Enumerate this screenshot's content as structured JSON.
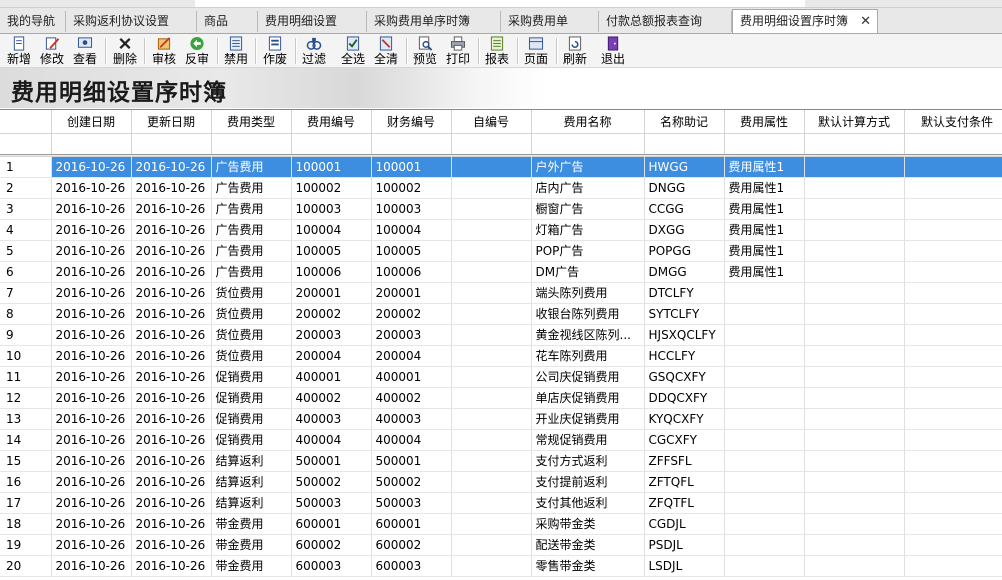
{
  "tabs": [
    {
      "label": "我的导航"
    },
    {
      "label": "采购返利协议设置"
    },
    {
      "label": "商品"
    },
    {
      "label": "费用明细设置"
    },
    {
      "label": "采购费用单序时簿"
    },
    {
      "label": "采购费用单"
    },
    {
      "label": "付款总额报表查询"
    },
    {
      "label": "费用明细设置序时簿",
      "active": true
    }
  ],
  "toolbar": [
    {
      "label": "新增",
      "icon": "new-doc-icon"
    },
    {
      "label": "修改",
      "icon": "edit-icon"
    },
    {
      "label": "查看",
      "icon": "view-icon"
    },
    {
      "label": "删除",
      "icon": "delete-icon"
    },
    {
      "label": "审核",
      "icon": "approve-icon"
    },
    {
      "label": "反审",
      "icon": "unapprove-icon"
    },
    {
      "label": "禁用",
      "icon": "disable-icon"
    },
    {
      "label": "作废",
      "icon": "void-icon"
    },
    {
      "label": "过滤",
      "icon": "filter-icon"
    },
    {
      "label": "全选",
      "icon": "select-all-icon"
    },
    {
      "label": "全清",
      "icon": "clear-all-icon"
    },
    {
      "label": "预览",
      "icon": "preview-icon"
    },
    {
      "label": "打印",
      "icon": "print-icon"
    },
    {
      "label": "报表",
      "icon": "report-icon"
    },
    {
      "label": "页面",
      "icon": "page-icon"
    },
    {
      "label": "刷新",
      "icon": "refresh-icon"
    },
    {
      "label": "退出",
      "icon": "exit-icon"
    }
  ],
  "page_title": "费用明细设置序时簿",
  "columns": [
    "创建日期",
    "更新日期",
    "费用类型",
    "费用编号",
    "财务编号",
    "自编号",
    "费用名称",
    "名称助记",
    "费用属性",
    "默认计算方式",
    "默认支付条件"
  ],
  "rows": [
    [
      "1",
      "2016-10-26",
      "2016-10-26",
      "广告费用",
      "100001",
      "100001",
      "",
      "户外广告",
      "HWGG",
      "费用属性1",
      "",
      ""
    ],
    [
      "2",
      "2016-10-26",
      "2016-10-26",
      "广告费用",
      "100002",
      "100002",
      "",
      "店内广告",
      "DNGG",
      "费用属性1",
      "",
      ""
    ],
    [
      "3",
      "2016-10-26",
      "2016-10-26",
      "广告费用",
      "100003",
      "100003",
      "",
      "橱窗广告",
      "CCGG",
      "费用属性1",
      "",
      ""
    ],
    [
      "4",
      "2016-10-26",
      "2016-10-26",
      "广告费用",
      "100004",
      "100004",
      "",
      "灯箱广告",
      "DXGG",
      "费用属性1",
      "",
      ""
    ],
    [
      "5",
      "2016-10-26",
      "2016-10-26",
      "广告费用",
      "100005",
      "100005",
      "",
      "POP广告",
      "POPGG",
      "费用属性1",
      "",
      ""
    ],
    [
      "6",
      "2016-10-26",
      "2016-10-26",
      "广告费用",
      "100006",
      "100006",
      "",
      "DM广告",
      "DMGG",
      "费用属性1",
      "",
      ""
    ],
    [
      "7",
      "2016-10-26",
      "2016-10-26",
      "货位费用",
      "200001",
      "200001",
      "",
      "端头陈列费用",
      "DTCLFY",
      "",
      "",
      ""
    ],
    [
      "8",
      "2016-10-26",
      "2016-10-26",
      "货位费用",
      "200002",
      "200002",
      "",
      "收银台陈列费用",
      "SYTCLFY",
      "",
      "",
      ""
    ],
    [
      "9",
      "2016-10-26",
      "2016-10-26",
      "货位费用",
      "200003",
      "200003",
      "",
      "黄金视线区陈列...",
      "HJSXQCLFY",
      "",
      "",
      ""
    ],
    [
      "10",
      "2016-10-26",
      "2016-10-26",
      "货位费用",
      "200004",
      "200004",
      "",
      "花车陈列费用",
      "HCCLFY",
      "",
      "",
      ""
    ],
    [
      "11",
      "2016-10-26",
      "2016-10-26",
      "促销费用",
      "400001",
      "400001",
      "",
      "公司庆促销费用",
      "GSQCXFY",
      "",
      "",
      ""
    ],
    [
      "12",
      "2016-10-26",
      "2016-10-26",
      "促销费用",
      "400002",
      "400002",
      "",
      "单店庆促销费用",
      "DDQCXFY",
      "",
      "",
      ""
    ],
    [
      "13",
      "2016-10-26",
      "2016-10-26",
      "促销费用",
      "400003",
      "400003",
      "",
      "开业庆促销费用",
      "KYQCXFY",
      "",
      "",
      ""
    ],
    [
      "14",
      "2016-10-26",
      "2016-10-26",
      "促销费用",
      "400004",
      "400004",
      "",
      "常规促销费用",
      "CGCXFY",
      "",
      "",
      ""
    ],
    [
      "15",
      "2016-10-26",
      "2016-10-26",
      "结算返利",
      "500001",
      "500001",
      "",
      "支付方式返利",
      "ZFFSFL",
      "",
      "",
      ""
    ],
    [
      "16",
      "2016-10-26",
      "2016-10-26",
      "结算返利",
      "500002",
      "500002",
      "",
      "支付提前返利",
      "ZFTQFL",
      "",
      "",
      ""
    ],
    [
      "17",
      "2016-10-26",
      "2016-10-26",
      "结算返利",
      "500003",
      "500003",
      "",
      "支付其他返利",
      "ZFQTFL",
      "",
      "",
      ""
    ],
    [
      "18",
      "2016-10-26",
      "2016-10-26",
      "带金费用",
      "600001",
      "600001",
      "",
      "采购带金类",
      "CGDJL",
      "",
      "",
      ""
    ],
    [
      "19",
      "2016-10-26",
      "2016-10-26",
      "带金费用",
      "600002",
      "600002",
      "",
      "配送带金类",
      "PSDJL",
      "",
      "",
      ""
    ],
    [
      "20",
      "2016-10-26",
      "2016-10-26",
      "带金费用",
      "600003",
      "600003",
      "",
      "零售带金类",
      "LSDJL",
      "",
      "",
      ""
    ]
  ],
  "selected_row": 1,
  "colors": {
    "selection": "#3d8ee0",
    "tab_bar": "#e8e8e8",
    "toolbar": "#f4f4f4"
  }
}
